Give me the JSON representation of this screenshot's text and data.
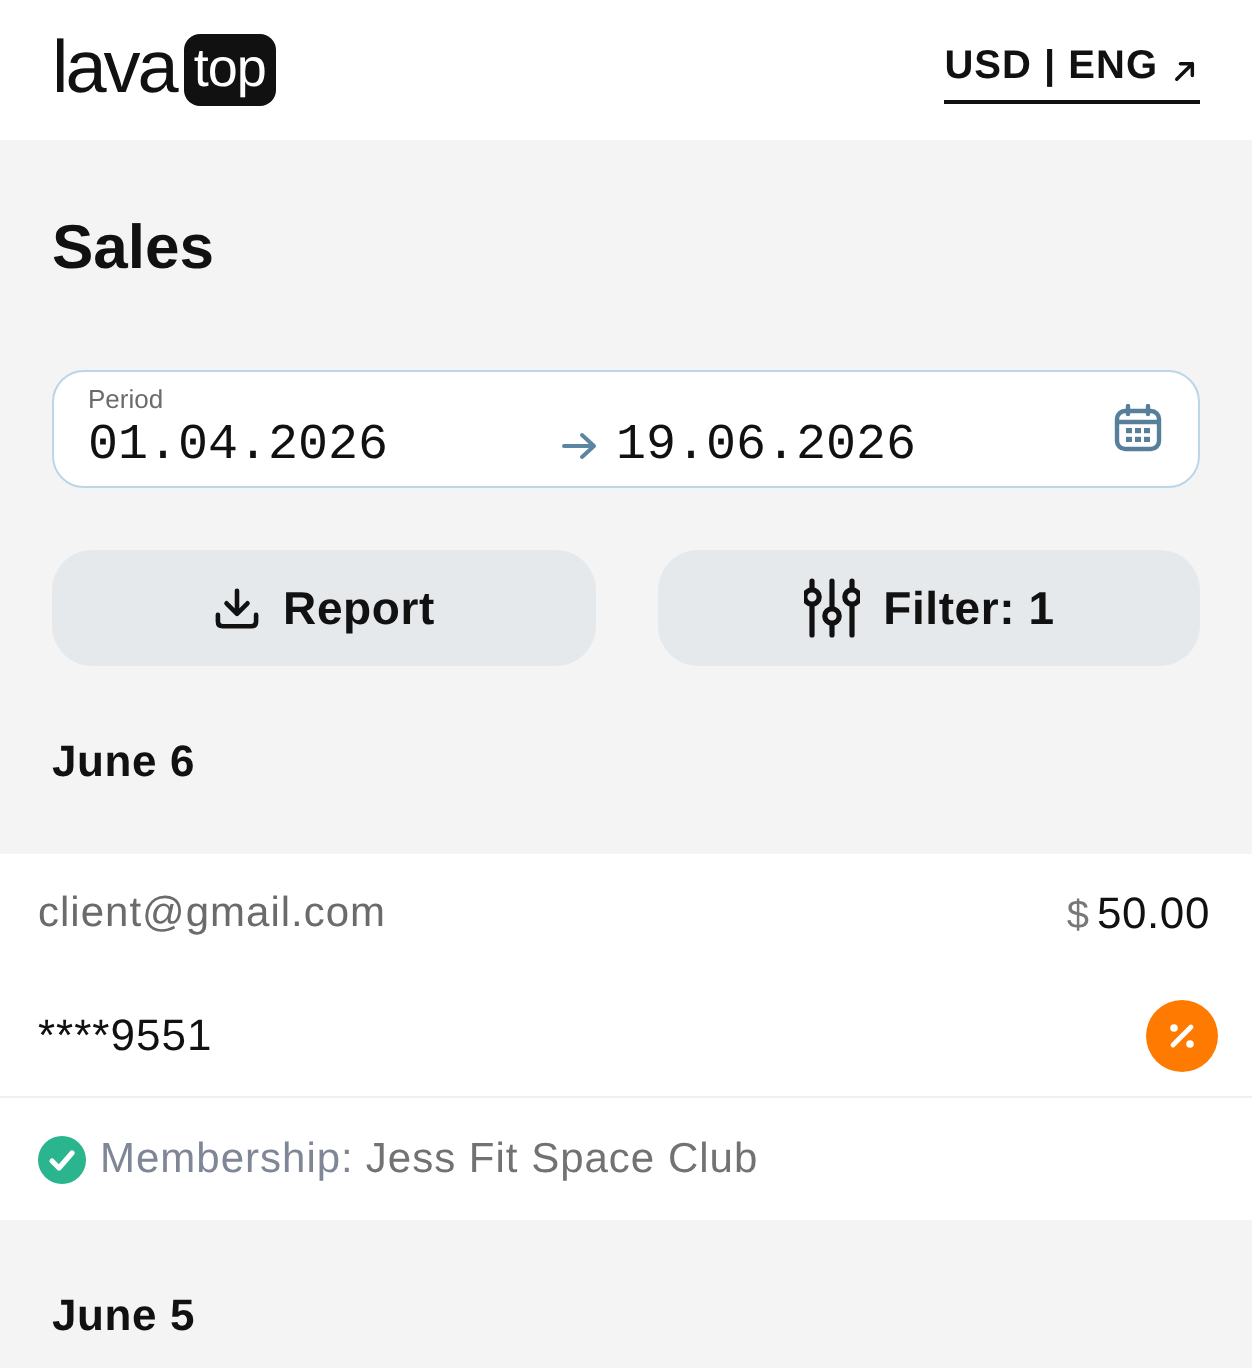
{
  "header": {
    "logo": {
      "word": "lava",
      "badge": "top"
    },
    "locale_link": "USD | ENG"
  },
  "page": {
    "title": "Sales"
  },
  "period": {
    "label": "Period",
    "from": "01.04.2026",
    "to": "19.06.2026"
  },
  "actions": [
    {
      "kind": "download",
      "label": "Report"
    },
    {
      "kind": "filter",
      "label": "Filter: 1"
    }
  ],
  "groups": [
    {
      "date": "June 6",
      "transactions": [
        {
          "email": "client@gmail.com",
          "currency": "$",
          "amount": "50.00",
          "card": "****9551",
          "discount": true,
          "completed": true,
          "product_type": "Membership:",
          "product_name": "Jess Fit Space Club"
        }
      ]
    },
    {
      "date": "June 5"
    }
  ]
}
